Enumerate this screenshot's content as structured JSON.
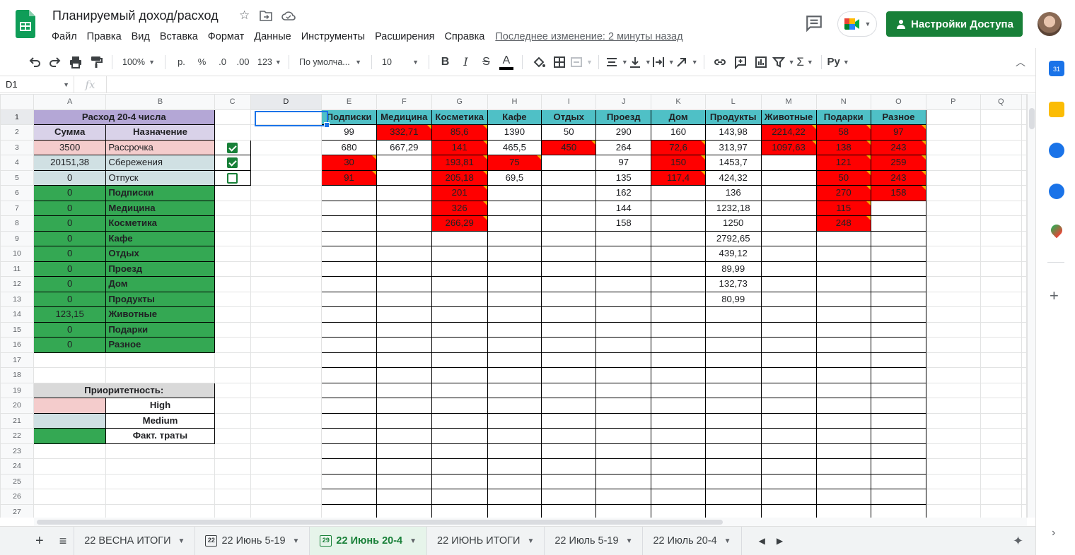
{
  "doc": {
    "title": "Планируемый доход/расход",
    "last_edit": "Последнее изменение: 2 минуты назад"
  },
  "menu": [
    "Файл",
    "Правка",
    "Вид",
    "Вставка",
    "Формат",
    "Данные",
    "Инструменты",
    "Расширения",
    "Справка"
  ],
  "share_label": "Настройки Доступа",
  "toolbar": {
    "zoom": "100%",
    "currency": "р.",
    "percent": "%",
    "dec_less": ".0",
    "dec_more": ".00",
    "more_formats": "123",
    "font": "По умолча...",
    "font_size": "10",
    "bold": "B",
    "italic": "I",
    "strike": "S",
    "text_color": "A",
    "input_tools": "Py"
  },
  "formula_bar": {
    "cell_ref": "D1",
    "fx": "fx",
    "content": ""
  },
  "columns": [
    "A",
    "B",
    "C",
    "D",
    "E",
    "F",
    "G",
    "H",
    "I",
    "J",
    "K",
    "L",
    "M",
    "N",
    "O",
    "P",
    "Q"
  ],
  "rows": [
    "1",
    "2",
    "3",
    "4",
    "5",
    "6",
    "7",
    "8",
    "9",
    "10",
    "11",
    "12",
    "13",
    "14",
    "15",
    "16",
    "17",
    "18",
    "19",
    "20",
    "21",
    "22",
    "23",
    "24",
    "25",
    "26",
    "27"
  ],
  "left_table": {
    "title": "Расход 20-4 числа",
    "header": {
      "amount": "Сумма",
      "purpose": "Назначение"
    },
    "planned": [
      {
        "amount": "3500",
        "purpose": "Рассрочка",
        "checked": true,
        "priority": "high"
      },
      {
        "amount": "20151,38",
        "purpose": "Сбережения",
        "checked": true,
        "priority": "medium"
      },
      {
        "amount": "0",
        "purpose": "Отпуск",
        "checked": false,
        "priority": "medium"
      }
    ],
    "actual": [
      {
        "amount": "0",
        "purpose": "Подписки"
      },
      {
        "amount": "0",
        "purpose": "Медицина"
      },
      {
        "amount": "0",
        "purpose": "Косметика"
      },
      {
        "amount": "0",
        "purpose": "Кафе"
      },
      {
        "amount": "0",
        "purpose": "Отдых"
      },
      {
        "amount": "0",
        "purpose": "Проезд"
      },
      {
        "amount": "0",
        "purpose": "Дом"
      },
      {
        "amount": "0",
        "purpose": "Продукты"
      },
      {
        "amount": "123,15",
        "purpose": "Животные"
      },
      {
        "amount": "0",
        "purpose": "Подарки"
      },
      {
        "amount": "0",
        "purpose": "Разное"
      }
    ]
  },
  "priority_legend": {
    "title": "Приоритетность:",
    "items": [
      {
        "label": "High",
        "color": "#f4cccc"
      },
      {
        "label": "Medium",
        "color": "#d0e0e3"
      },
      {
        "label": "Факт. траты",
        "color": "#34a853"
      }
    ]
  },
  "expenses": {
    "headers": [
      "Подписки",
      "Медицина",
      "Косметика",
      "Кафе",
      "Отдых",
      "Проезд",
      "Дом",
      "Продукты",
      "Животные",
      "Подарки",
      "Разное"
    ],
    "rows": [
      [
        [
          "99",
          0
        ],
        [
          "332,71",
          1
        ],
        [
          "85,6",
          1
        ],
        [
          "1390",
          0
        ],
        [
          "50",
          0
        ],
        [
          "290",
          0
        ],
        [
          "160",
          0
        ],
        [
          "143,98",
          0
        ],
        [
          "2214,22",
          1
        ],
        [
          "58",
          1
        ],
        [
          "97",
          1
        ]
      ],
      [
        [
          "680",
          0
        ],
        [
          "667,29",
          0
        ],
        [
          "141",
          1
        ],
        [
          "465,5",
          0
        ],
        [
          "450",
          1
        ],
        [
          "264",
          0
        ],
        [
          "72,6",
          1
        ],
        [
          "313,97",
          0
        ],
        [
          "1097,63",
          1
        ],
        [
          "138",
          1
        ],
        [
          "243",
          1
        ]
      ],
      [
        [
          "30",
          1
        ],
        [
          "",
          0
        ],
        [
          "193,81",
          1
        ],
        [
          "75",
          1
        ],
        [
          "",
          0
        ],
        [
          "97",
          0
        ],
        [
          "150",
          1
        ],
        [
          "1453,7",
          0
        ],
        [
          "",
          0
        ],
        [
          "121",
          1
        ],
        [
          "259",
          1
        ]
      ],
      [
        [
          "91",
          1
        ],
        [
          "",
          0
        ],
        [
          "205,18",
          1
        ],
        [
          "69,5",
          0
        ],
        [
          "",
          0
        ],
        [
          "135",
          0
        ],
        [
          "117,4",
          1
        ],
        [
          "424,32",
          0
        ],
        [
          "",
          0
        ],
        [
          "50",
          1
        ],
        [
          "243",
          1
        ]
      ],
      [
        [
          "",
          0
        ],
        [
          "",
          0
        ],
        [
          "201",
          1
        ],
        [
          "",
          0
        ],
        [
          "",
          0
        ],
        [
          "162",
          0
        ],
        [
          "",
          0
        ],
        [
          "136",
          0
        ],
        [
          "",
          0
        ],
        [
          "270",
          1
        ],
        [
          "158",
          1
        ]
      ],
      [
        [
          "",
          0
        ],
        [
          "",
          0
        ],
        [
          "326",
          1
        ],
        [
          "",
          0
        ],
        [
          "",
          0
        ],
        [
          "144",
          0
        ],
        [
          "",
          0
        ],
        [
          "1232,18",
          0
        ],
        [
          "",
          0
        ],
        [
          "115",
          1
        ],
        [
          "",
          0
        ]
      ],
      [
        [
          "",
          0
        ],
        [
          "",
          0
        ],
        [
          "266,29",
          1
        ],
        [
          "",
          0
        ],
        [
          "",
          0
        ],
        [
          "158",
          0
        ],
        [
          "",
          0
        ],
        [
          "1250",
          0
        ],
        [
          "",
          0
        ],
        [
          "248",
          1
        ],
        [
          "",
          0
        ]
      ],
      [
        [
          "",
          0
        ],
        [
          "",
          0
        ],
        [
          "",
          0
        ],
        [
          "",
          0
        ],
        [
          "",
          0
        ],
        [
          "",
          0
        ],
        [
          "",
          0
        ],
        [
          "2792,65",
          0
        ],
        [
          "",
          0
        ],
        [
          "",
          0
        ],
        [
          "",
          0
        ]
      ],
      [
        [
          "",
          0
        ],
        [
          "",
          0
        ],
        [
          "",
          0
        ],
        [
          "",
          0
        ],
        [
          "",
          0
        ],
        [
          "",
          0
        ],
        [
          "",
          0
        ],
        [
          "439,12",
          0
        ],
        [
          "",
          0
        ],
        [
          "",
          0
        ],
        [
          "",
          0
        ]
      ],
      [
        [
          "",
          0
        ],
        [
          "",
          0
        ],
        [
          "",
          0
        ],
        [
          "",
          0
        ],
        [
          "",
          0
        ],
        [
          "",
          0
        ],
        [
          "",
          0
        ],
        [
          "89,99",
          0
        ],
        [
          "",
          0
        ],
        [
          "",
          0
        ],
        [
          "",
          0
        ]
      ],
      [
        [
          "",
          0
        ],
        [
          "",
          0
        ],
        [
          "",
          0
        ],
        [
          "",
          0
        ],
        [
          "",
          0
        ],
        [
          "",
          0
        ],
        [
          "",
          0
        ],
        [
          "132,73",
          0
        ],
        [
          "",
          0
        ],
        [
          "",
          0
        ],
        [
          "",
          0
        ]
      ],
      [
        [
          "",
          0
        ],
        [
          "",
          0
        ],
        [
          "",
          0
        ],
        [
          "",
          0
        ],
        [
          "",
          0
        ],
        [
          "",
          0
        ],
        [
          "",
          0
        ],
        [
          "80,99",
          0
        ],
        [
          "",
          0
        ],
        [
          "",
          0
        ],
        [
          "",
          0
        ]
      ]
    ]
  },
  "sheet_tabs": [
    {
      "label": "22 ВЕСНА ИТОГИ",
      "icon": "",
      "active": false
    },
    {
      "label": "22 Июнь 5-19",
      "icon": "22",
      "active": false
    },
    {
      "label": "22 Июнь 20-4",
      "icon": "29",
      "active": true
    },
    {
      "label": "22 ИЮНЬ ИТОГИ",
      "icon": "",
      "active": false
    },
    {
      "label": "22 Июль 5-19",
      "icon": "",
      "active": false
    },
    {
      "label": "22 Июль 20-4",
      "icon": "",
      "active": false
    }
  ],
  "colors": {
    "accent": "#188038",
    "header_teal": "#4fc0c6",
    "over_budget": "#ff0000",
    "title_purple": "#b4a7d6",
    "selection": "#1a73e8"
  }
}
